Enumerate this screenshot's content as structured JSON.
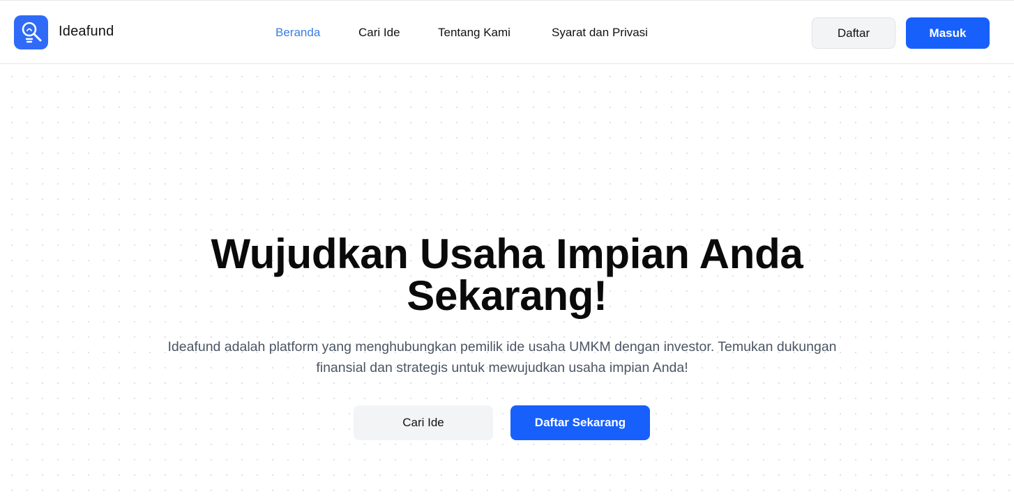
{
  "brand": {
    "name": "Ideafund",
    "logo_icon": "lightbulb-search-icon",
    "color": "#2f6bf6"
  },
  "nav": {
    "items": [
      {
        "label": "Beranda",
        "active": true
      },
      {
        "label": "Cari Ide",
        "active": false
      },
      {
        "label": "Tentang Kami",
        "active": false
      },
      {
        "label": "Syarat dan Privasi",
        "active": false
      }
    ],
    "active_color": "#3b7de0"
  },
  "header_actions": {
    "register_label": "Daftar",
    "login_label": "Masuk",
    "primary_color": "#1860fb"
  },
  "hero": {
    "title_line1": "Wujudkan Usaha Impian Anda",
    "title_line2": "Sekarang!",
    "description_line1": "Ideafund adalah platform yang menghubungkan pemilik ide usaha UMKM dengan investor. Temukan dukungan",
    "description_line2": "finansial dan strategis untuk mewujudkan usaha impian Anda!",
    "secondary_cta": "Cari Ide",
    "primary_cta": "Daftar Sekarang"
  }
}
